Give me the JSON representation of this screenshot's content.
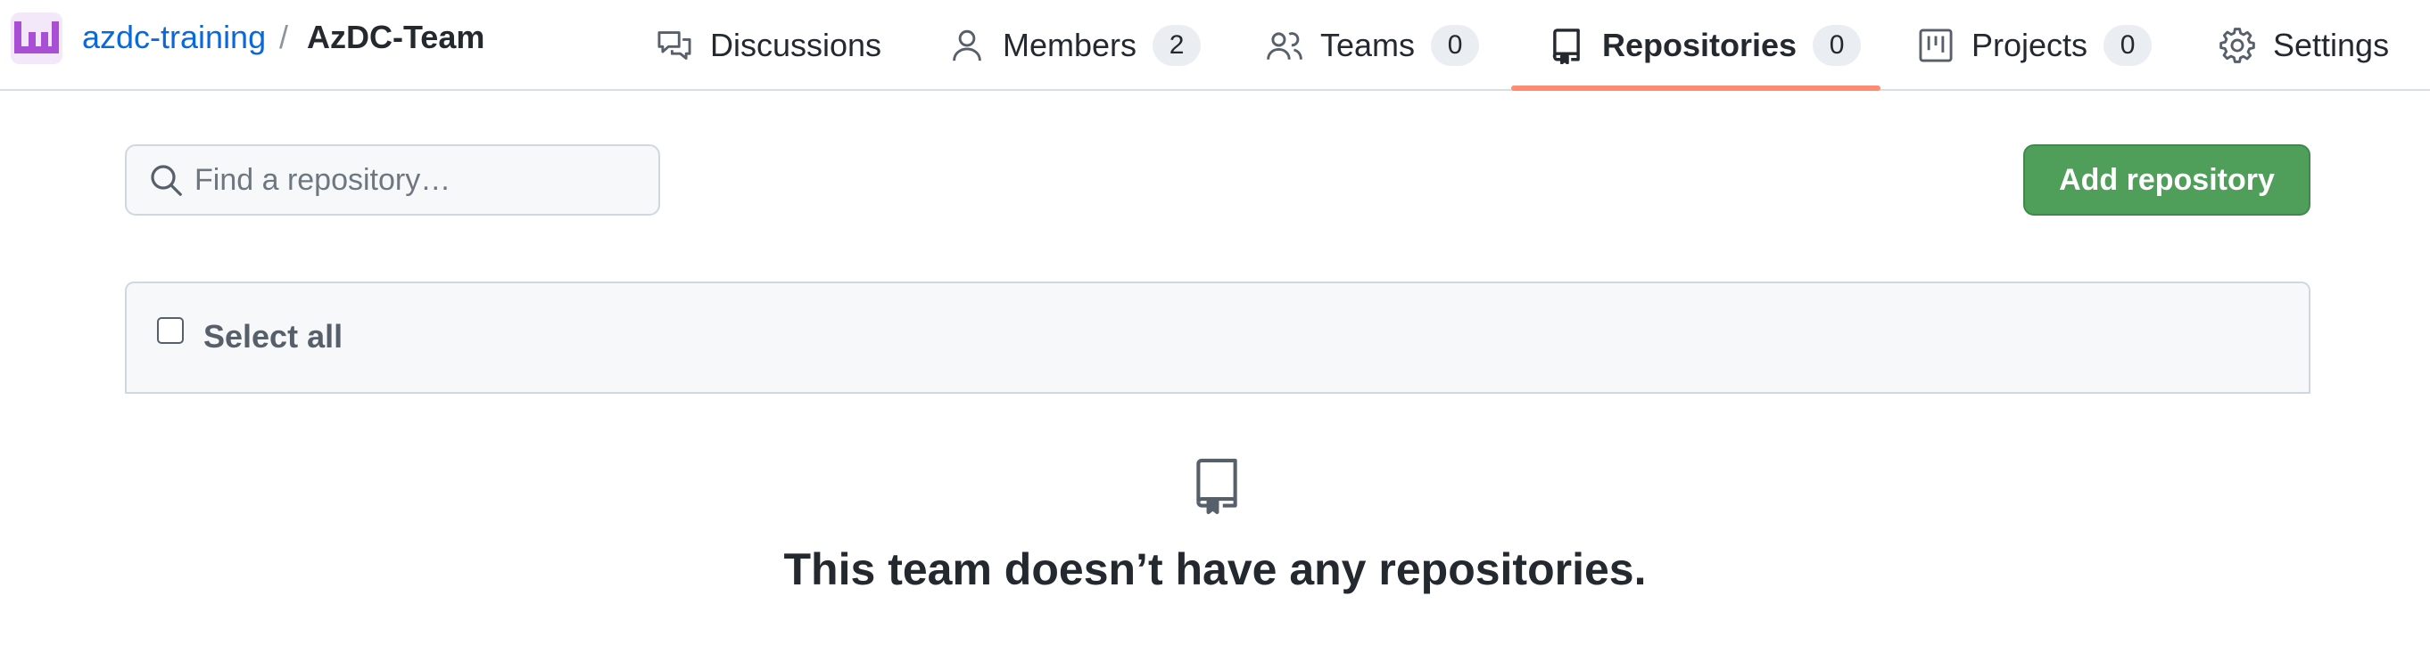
{
  "breadcrumb": {
    "org": "azdc-training",
    "separator": "/",
    "team": "AzDC-Team"
  },
  "tabs": [
    {
      "label": "Discussions",
      "icon": "comment-discussion-icon"
    },
    {
      "label": "Members",
      "icon": "person-icon",
      "count": "2"
    },
    {
      "label": "Teams",
      "icon": "people-icon",
      "count": "0"
    },
    {
      "label": "Repositories",
      "icon": "repo-icon",
      "count": "0",
      "selected": true
    },
    {
      "label": "Projects",
      "icon": "project-icon",
      "count": "0"
    },
    {
      "label": "Settings",
      "icon": "gear-icon"
    }
  ],
  "search": {
    "placeholder": "Find a repository…",
    "value": ""
  },
  "actions": {
    "add_repository": "Add repository"
  },
  "list": {
    "select_all": "Select all"
  },
  "empty_state": {
    "icon": "repo-icon",
    "title": "This team doesn’t have any repositories."
  },
  "colors": {
    "link": "#0969da",
    "selected_underline": "#fd8c73",
    "primary_button": "#4f9e5a",
    "avatar": "#a94fd6"
  }
}
